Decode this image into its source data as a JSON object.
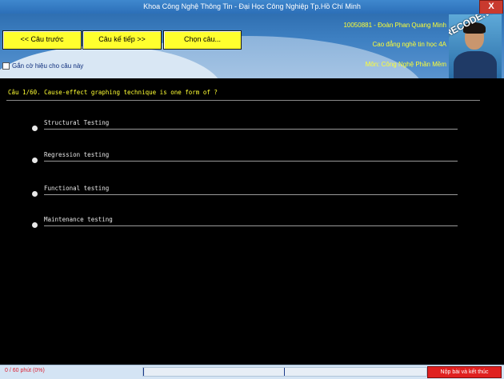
{
  "window": {
    "title": "Khoa Công Nghệ Thông Tin - Đại Học Công Nghiệp Tp.Hồ Chí Minh",
    "close_label": "X"
  },
  "toolbar": {
    "prev_label": "<< Câu trước",
    "next_label": "Câu kế tiếp >>",
    "choose_label": "Chọn câu..."
  },
  "flag": {
    "label": "Gắn cờ hiệu cho câu này",
    "checked": false
  },
  "student": {
    "id_name": "10050881 - Đoàn Phan Quang Minh",
    "class": "Cao đẳng nghề tin học 4A",
    "subject": "Môn: Công Nghệ Phần Mềm"
  },
  "watermark": "SHARECODE.vn",
  "question": {
    "text": "Câu 1/60. Cause-effect graphing technique is one form of ?",
    "options": [
      "Structural Testing",
      "Regression testing",
      "Functional testing",
      "Maintenance testing"
    ]
  },
  "status": {
    "timer": "0 / 60 phút (0%)",
    "progress": 0,
    "submit_label": "Nộp bài và kết thúc"
  },
  "colors": {
    "accent": "#ffff2e",
    "header_blue": "#2f6fb1",
    "question_text": "#ffff33",
    "submit_red": "#e02020"
  }
}
